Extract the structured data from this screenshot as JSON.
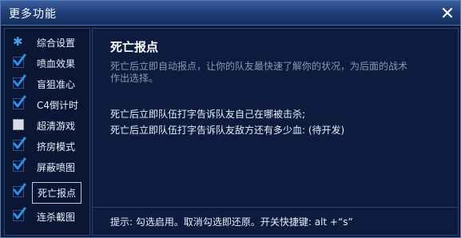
{
  "window": {
    "title": "更多功能",
    "close_icon": "close-icon"
  },
  "sidebar": {
    "items": [
      {
        "label": "综合设置",
        "icon": "gear-icon",
        "state": "icon"
      },
      {
        "label": "喷血效果",
        "icon": "checkbox-checked-icon",
        "state": "checked"
      },
      {
        "label": "盲狙准心",
        "icon": "checkbox-checked-icon",
        "state": "checked"
      },
      {
        "label": "C4倒计时",
        "icon": "checkbox-checked-icon",
        "state": "checked"
      },
      {
        "label": "超清游戏",
        "icon": "checkbox-empty-icon",
        "state": "unchecked"
      },
      {
        "label": "挤房模式",
        "icon": "checkbox-checked-icon",
        "state": "checked"
      },
      {
        "label": "屏蔽喷图",
        "icon": "checkbox-checked-icon",
        "state": "checked"
      },
      {
        "label": "死亡报点",
        "icon": "checkbox-checked-icon",
        "state": "checked",
        "selected": true
      },
      {
        "label": "连杀截图",
        "icon": "checkbox-checked-icon",
        "state": "checked"
      }
    ]
  },
  "content": {
    "title": "死亡报点",
    "description": "死亡后立即自动报点，让你的队友最快速了解你的状况，为后面的战术作出选择。",
    "line1": "死亡后立即队伍打字告诉队友自己在哪被击杀;",
    "line2": "死亡后立即队伍打字告诉队友敌方还有多少血: (待开发)"
  },
  "footer": {
    "hint": "提示: 勾选启用。取消勾选即还原。开关快捷键: alt +“s”"
  },
  "colors": {
    "accent": "#3fa0f0",
    "check": "#2f8ee8",
    "title_bar": "#20407a"
  }
}
